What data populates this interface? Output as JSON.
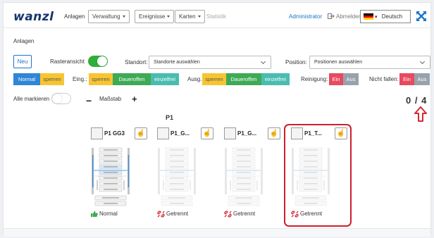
{
  "nav": {
    "logo": "wanzl",
    "anlagen": "Anlagen",
    "verwaltung": "Verwaltung",
    "ereignisse": "Ereignisse",
    "karten": "Karten",
    "statistik": "Statistik",
    "admin": "Administrator",
    "logout": "Abmelden",
    "language": "Deutsch"
  },
  "section_title": "Anlagen",
  "toolbar": {
    "neu": "Neu",
    "rasteransicht": "Rasteransicht",
    "standort_label": "Standort:",
    "standort_placeholder": "Standorte auswählen",
    "position_label": "Position:",
    "position_placeholder": "Positionen auswählen"
  },
  "filters": {
    "normal": "Normal",
    "sperren1": "sperren",
    "eing_label": "Eing.:",
    "eing_sperren": "sperren",
    "eing_daueroffen": "Daueroffen",
    "eing_einzelfrei": "einzelfrei",
    "ausg_label": "Ausg.:",
    "ausg_sperren": "sperren",
    "ausg_daueroffen": "Daueroffen",
    "ausg_einzelfrei": "einzelfrei",
    "reinigung_label": "Reinigung:",
    "reinigung_ein": "Ein",
    "reinigung_aus": "Aus",
    "nichtfallen_label": "Nicht fallen:",
    "nichtfallen_ein": "Ein",
    "nichtfallen_aus": "Aus"
  },
  "controls": {
    "alle_markieren": "Alle markieren",
    "massstab": "Maßstab",
    "counter": "0 / 4"
  },
  "group_title": "P1",
  "cards": [
    {
      "name": "P1 GG3",
      "status": "Normal",
      "status_type": "ok"
    },
    {
      "name": "P1_G...",
      "status": "Getrennt",
      "status_type": "disconnected"
    },
    {
      "name": "P1_G...",
      "status": "Getrennt",
      "status_type": "disconnected"
    },
    {
      "name": "P1_T...",
      "status": "Getrennt",
      "status_type": "disconnected"
    }
  ],
  "colors": {
    "blue": "#2f86d6",
    "yellow": "#f7c531",
    "green": "#3eaa55",
    "teal": "#48bdb0",
    "red": "#e84a5f",
    "grey": "#98a2ad",
    "highlight": "#cc1f2c"
  }
}
